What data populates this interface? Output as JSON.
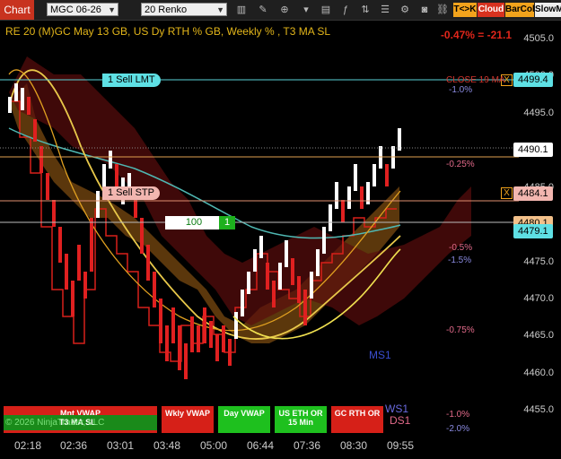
{
  "toolbar": {
    "title": "Chart",
    "instrument": "MGC 06-26",
    "period": "20 Renko",
    "buttons": {
      "tk": "T<>K",
      "cloud": "Cloud",
      "barcol": "BarCol",
      "slowm": "SlowM"
    }
  },
  "header": {
    "label": "RE 20  (M)GC May 13 GB, US Dy RTH % GB, Weekly % , T3 MA SL",
    "pnl": "-0.47% = -21.1"
  },
  "orders": {
    "sell_limit": "1 Sell LMT",
    "sell_stop": "1 Sell STP",
    "qty": "100",
    "qty_count": "1",
    "close_x": "X"
  },
  "annotations": {
    "close_ma": "CLOSE 19 MA",
    "p1_0": "-1.0%",
    "p0_25": "-0.25%",
    "p0_5": "-0.5%",
    "p1_5": "-1.5%",
    "p0_75": "-0.75%",
    "p1_0b": "-1.0%",
    "p2_0": "-2.0%",
    "ms1": "MS1",
    "ws1": "WS1",
    "ds1": "DS1"
  },
  "footer": {
    "mnt_vwap": "Mnt VWAP",
    "t3_ma_sl": "T3 MA SL",
    "copyright": "© 2026 NinjaTrader, LLC",
    "wkly_vwap": "Wkly VWAP",
    "day_vwap": "Day VWAP",
    "us_eth_or": "US ETH OR 15 Min",
    "gc_rth_or": "GC RTH OR"
  },
  "yaxis": {
    "ticks": [
      "4505.0",
      "4500.0",
      "4495.0",
      "4490.0",
      "4485.0",
      "4480.0",
      "4475.0",
      "4470.0",
      "4465.0",
      "4460.0",
      "4455.0"
    ],
    "labels": {
      "sell_lmt": "4499.4",
      "last": "4490.1",
      "sell_stp": "4484.1",
      "entry": "4480.1",
      "ma": "4479.1"
    }
  },
  "xaxis": {
    "ticks": [
      "02:18",
      "02:36",
      "03:01",
      "03:48",
      "05:00",
      "06:44",
      "07:36",
      "08:30",
      "09:55"
    ]
  },
  "colors": {
    "up_bar": "#ffffff",
    "down_bar": "#e02020",
    "cloud": "#8a5a10",
    "accent": "#e2b51a"
  }
}
